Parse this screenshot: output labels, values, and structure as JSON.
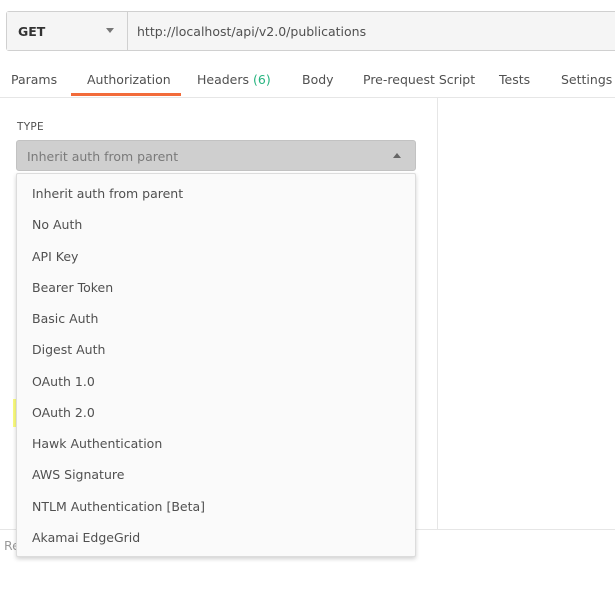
{
  "request": {
    "method": "GET",
    "url": "http://localhost/api/v2.0/publications"
  },
  "tabs": [
    {
      "label": "Params"
    },
    {
      "label": "Authorization",
      "active": true
    },
    {
      "label": "Headers",
      "count": "(6)"
    },
    {
      "label": "Body"
    },
    {
      "label": "Pre-request Script"
    },
    {
      "label": "Tests"
    },
    {
      "label": "Settings"
    }
  ],
  "auth": {
    "type_label": "TYPE",
    "selected": "Inherit auth from parent",
    "options": [
      "Inherit auth from parent",
      "No Auth",
      "API Key",
      "Bearer Token",
      "Basic Auth",
      "Digest Auth",
      "OAuth 1.0",
      "OAuth 2.0",
      "Hawk Authentication",
      "AWS Signature",
      "NTLM Authentication [Beta]",
      "Akamai EdgeGrid"
    ],
    "highlighted_option": "OAuth 2.0",
    "highlight_color": "#fbfc7e"
  },
  "colors": {
    "active_tab_underline": "#f26b3a",
    "header_count": "#26b47f"
  },
  "footer": {
    "truncated_text": "Re"
  }
}
